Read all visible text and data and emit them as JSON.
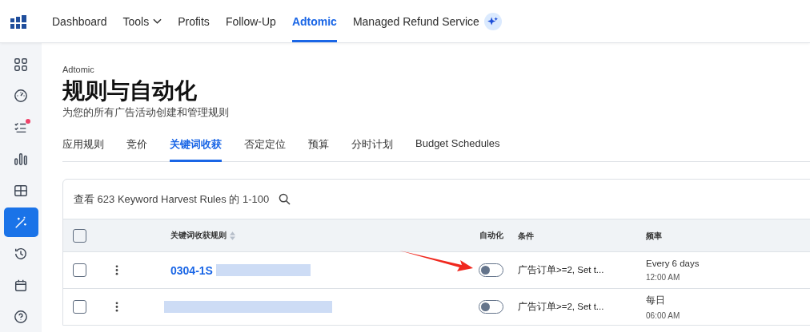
{
  "top_nav": {
    "items": [
      {
        "label": "Dashboard",
        "selected": false,
        "dropdown": false
      },
      {
        "label": "Tools",
        "selected": false,
        "dropdown": true
      },
      {
        "label": "Profits",
        "selected": false,
        "dropdown": false
      },
      {
        "label": "Follow-Up",
        "selected": false,
        "dropdown": false
      },
      {
        "label": "Adtomic",
        "selected": true,
        "dropdown": false
      },
      {
        "label": "Managed Refund Service",
        "selected": false,
        "dropdown": false
      }
    ]
  },
  "sidebar": {
    "items": [
      {
        "kind": "grid",
        "selected": false,
        "alert": false
      },
      {
        "kind": "gauge",
        "selected": false,
        "alert": false
      },
      {
        "kind": "checklist",
        "selected": false,
        "alert": true
      },
      {
        "kind": "bars",
        "selected": false,
        "alert": false
      },
      {
        "kind": "table",
        "selected": false,
        "alert": false
      },
      {
        "kind": "wand",
        "selected": true,
        "alert": false
      },
      {
        "kind": "history",
        "selected": false,
        "alert": false
      },
      {
        "kind": "calendar",
        "selected": false,
        "alert": false
      },
      {
        "kind": "help",
        "selected": false,
        "alert": false
      }
    ]
  },
  "page": {
    "breadcrumb": "Adtomic",
    "title": "规则与自动化",
    "subtitle": "为您的所有广告活动创建和管理规则"
  },
  "tabs": [
    {
      "label": "应用规则",
      "selected": false
    },
    {
      "label": "竞价",
      "selected": false
    },
    {
      "label": "关键词收获",
      "selected": true
    },
    {
      "label": "否定定位",
      "selected": false
    },
    {
      "label": "预算",
      "selected": false
    },
    {
      "label": "分时计划",
      "selected": false
    },
    {
      "label": "Budget Schedules",
      "selected": false
    }
  ],
  "table": {
    "select_all_checked": false,
    "summary": "查看 623 Keyword Harvest Rules 的 1-100",
    "columns": [
      "关键词收获规则",
      "自动化",
      "条件",
      "频率"
    ],
    "rows": [
      {
        "checked": false,
        "name": "0304-1S",
        "automation_on": false,
        "condition": "广告订单>=2, Set t...",
        "frequency": "Every 6 days",
        "time": "12:00 AM"
      },
      {
        "checked": false,
        "automation_on": false,
        "condition": "广告订单>=2, Set t...",
        "frequency": "每日",
        "time": "06:00 AM"
      }
    ]
  }
}
